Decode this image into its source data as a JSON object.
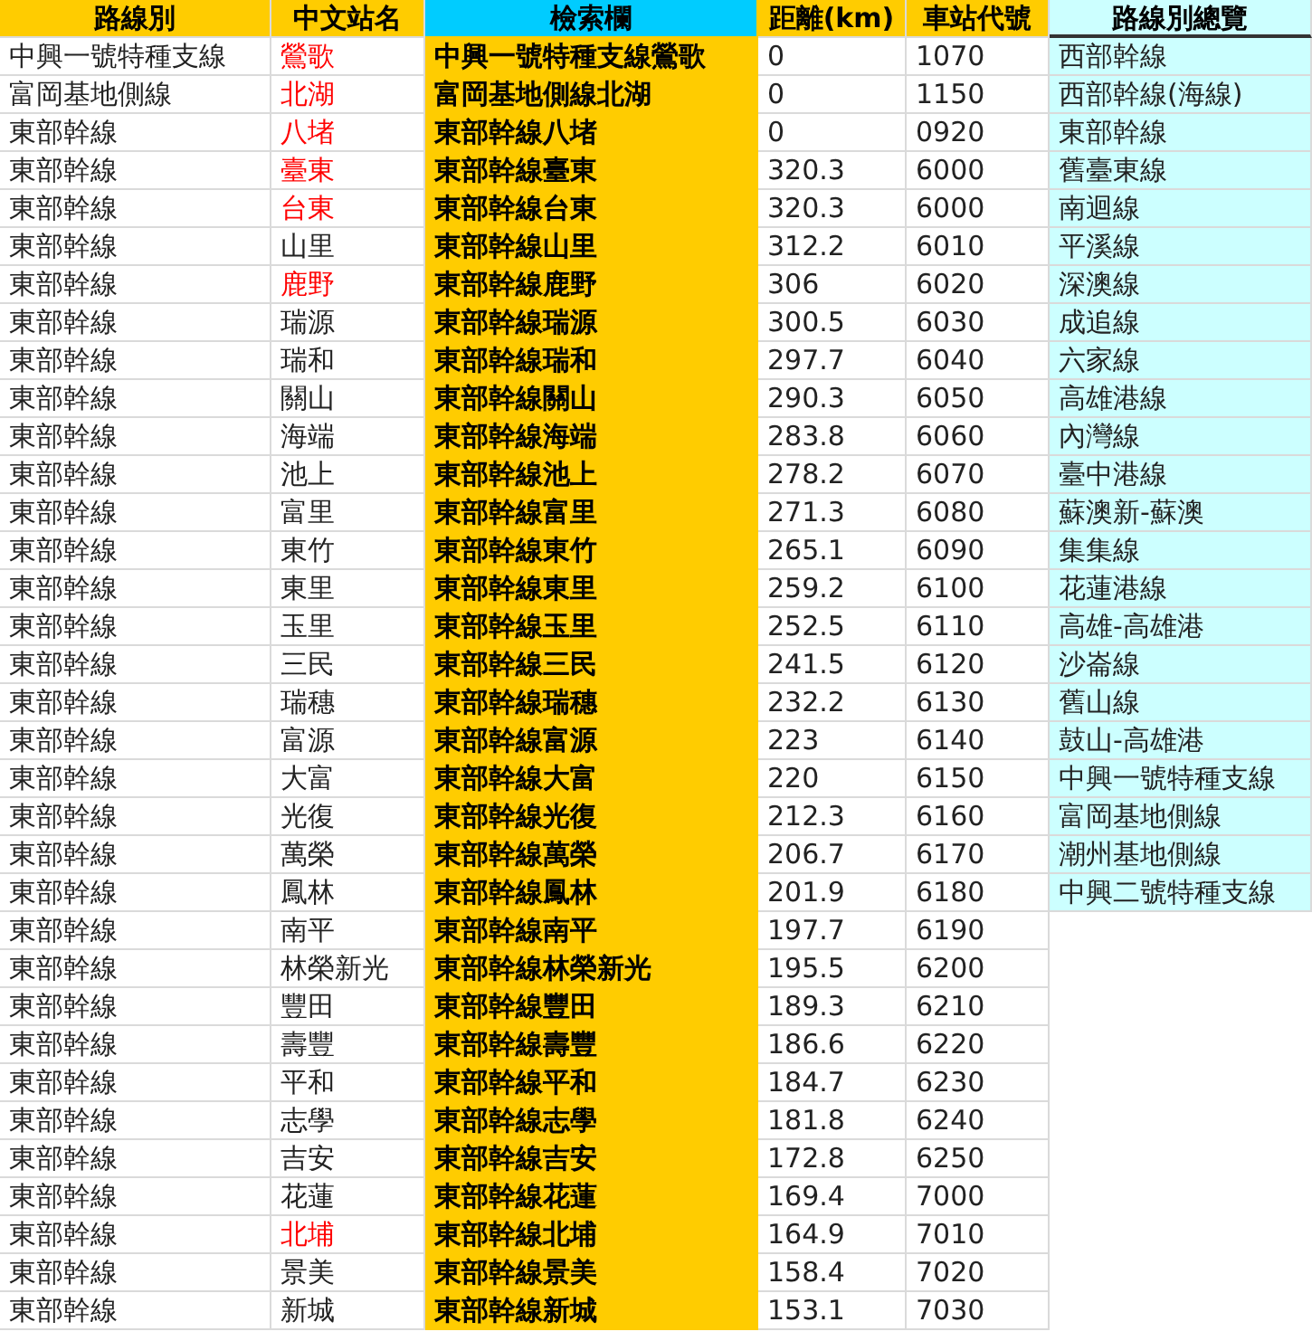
{
  "columns": [
    {
      "label": "路線別",
      "kind": "plain"
    },
    {
      "label": "中文站名",
      "kind": "plain"
    },
    {
      "label": "檢索欄",
      "kind": "search"
    },
    {
      "label": "距離(km)",
      "kind": "plain"
    },
    {
      "label": "車站代號",
      "kind": "plain"
    },
    {
      "label": "路線別總覽",
      "kind": "overview"
    }
  ],
  "rows": [
    {
      "route": "中興一號特種支線",
      "station": "鶯歌",
      "highlighted": true,
      "search_key": "中興一號特種支線鶯歌",
      "distance": "0",
      "code": "1070"
    },
    {
      "route": "富岡基地側線",
      "station": "北湖",
      "highlighted": true,
      "search_key": "富岡基地側線北湖",
      "distance": "0",
      "code": "1150"
    },
    {
      "route": "東部幹線",
      "station": "八堵",
      "highlighted": true,
      "search_key": "東部幹線八堵",
      "distance": "0",
      "code": "0920"
    },
    {
      "route": "東部幹線",
      "station": "臺東",
      "highlighted": true,
      "search_key": "東部幹線臺東",
      "distance": "320.3",
      "code": "6000"
    },
    {
      "route": "東部幹線",
      "station": "台東",
      "highlighted": true,
      "search_key": "東部幹線台東",
      "distance": "320.3",
      "code": "6000"
    },
    {
      "route": "東部幹線",
      "station": "山里",
      "highlighted": false,
      "search_key": "東部幹線山里",
      "distance": "312.2",
      "code": "6010"
    },
    {
      "route": "東部幹線",
      "station": "鹿野",
      "highlighted": true,
      "search_key": "東部幹線鹿野",
      "distance": "306",
      "code": "6020"
    },
    {
      "route": "東部幹線",
      "station": "瑞源",
      "highlighted": false,
      "search_key": "東部幹線瑞源",
      "distance": "300.5",
      "code": "6030"
    },
    {
      "route": "東部幹線",
      "station": "瑞和",
      "highlighted": false,
      "search_key": "東部幹線瑞和",
      "distance": "297.7",
      "code": "6040"
    },
    {
      "route": "東部幹線",
      "station": "關山",
      "highlighted": false,
      "search_key": "東部幹線關山",
      "distance": "290.3",
      "code": "6050"
    },
    {
      "route": "東部幹線",
      "station": "海端",
      "highlighted": false,
      "search_key": "東部幹線海端",
      "distance": "283.8",
      "code": "6060"
    },
    {
      "route": "東部幹線",
      "station": "池上",
      "highlighted": false,
      "search_key": "東部幹線池上",
      "distance": "278.2",
      "code": "6070"
    },
    {
      "route": "東部幹線",
      "station": "富里",
      "highlighted": false,
      "search_key": "東部幹線富里",
      "distance": "271.3",
      "code": "6080"
    },
    {
      "route": "東部幹線",
      "station": "東竹",
      "highlighted": false,
      "search_key": "東部幹線東竹",
      "distance": "265.1",
      "code": "6090"
    },
    {
      "route": "東部幹線",
      "station": "東里",
      "highlighted": false,
      "search_key": "東部幹線東里",
      "distance": "259.2",
      "code": "6100"
    },
    {
      "route": "東部幹線",
      "station": "玉里",
      "highlighted": false,
      "search_key": "東部幹線玉里",
      "distance": "252.5",
      "code": "6110"
    },
    {
      "route": "東部幹線",
      "station": "三民",
      "highlighted": false,
      "search_key": "東部幹線三民",
      "distance": "241.5",
      "code": "6120"
    },
    {
      "route": "東部幹線",
      "station": "瑞穗",
      "highlighted": false,
      "search_key": "東部幹線瑞穗",
      "distance": "232.2",
      "code": "6130"
    },
    {
      "route": "東部幹線",
      "station": "富源",
      "highlighted": false,
      "search_key": "東部幹線富源",
      "distance": "223",
      "code": "6140"
    },
    {
      "route": "東部幹線",
      "station": "大富",
      "highlighted": false,
      "search_key": "東部幹線大富",
      "distance": "220",
      "code": "6150"
    },
    {
      "route": "東部幹線",
      "station": "光復",
      "highlighted": false,
      "search_key": "東部幹線光復",
      "distance": "212.3",
      "code": "6160"
    },
    {
      "route": "東部幹線",
      "station": "萬榮",
      "highlighted": false,
      "search_key": "東部幹線萬榮",
      "distance": "206.7",
      "code": "6170"
    },
    {
      "route": "東部幹線",
      "station": "鳳林",
      "highlighted": false,
      "search_key": "東部幹線鳳林",
      "distance": "201.9",
      "code": "6180"
    },
    {
      "route": "東部幹線",
      "station": "南平",
      "highlighted": false,
      "search_key": "東部幹線南平",
      "distance": "197.7",
      "code": "6190"
    },
    {
      "route": "東部幹線",
      "station": "林榮新光",
      "highlighted": false,
      "search_key": "東部幹線林榮新光",
      "distance": "195.5",
      "code": "6200"
    },
    {
      "route": "東部幹線",
      "station": "豐田",
      "highlighted": false,
      "search_key": "東部幹線豐田",
      "distance": "189.3",
      "code": "6210"
    },
    {
      "route": "東部幹線",
      "station": "壽豐",
      "highlighted": false,
      "search_key": "東部幹線壽豐",
      "distance": "186.6",
      "code": "6220"
    },
    {
      "route": "東部幹線",
      "station": "平和",
      "highlighted": false,
      "search_key": "東部幹線平和",
      "distance": "184.7",
      "code": "6230"
    },
    {
      "route": "東部幹線",
      "station": "志學",
      "highlighted": false,
      "search_key": "東部幹線志學",
      "distance": "181.8",
      "code": "6240"
    },
    {
      "route": "東部幹線",
      "station": "吉安",
      "highlighted": false,
      "search_key": "東部幹線吉安",
      "distance": "172.8",
      "code": "6250"
    },
    {
      "route": "東部幹線",
      "station": "花蓮",
      "highlighted": false,
      "search_key": "東部幹線花蓮",
      "distance": "169.4",
      "code": "7000"
    },
    {
      "route": "東部幹線",
      "station": "北埔",
      "highlighted": true,
      "search_key": "東部幹線北埔",
      "distance": "164.9",
      "code": "7010"
    },
    {
      "route": "東部幹線",
      "station": "景美",
      "highlighted": false,
      "search_key": "東部幹線景美",
      "distance": "158.4",
      "code": "7020"
    },
    {
      "route": "東部幹線",
      "station": "新城",
      "highlighted": false,
      "search_key": "東部幹線新城",
      "distance": "153.1",
      "code": "7030"
    }
  ],
  "overview": [
    "西部幹線",
    "西部幹線(海線)",
    "東部幹線",
    "舊臺東線",
    "南迴線",
    "平溪線",
    "深澳線",
    "成追線",
    "六家線",
    "高雄港線",
    "內灣線",
    "臺中港線",
    "蘇澳新-蘇澳",
    "集集線",
    "花蓮港線",
    "高雄-高雄港",
    "沙崙線",
    "舊山線",
    "鼓山-高雄港",
    "中興一號特種支線",
    "富岡基地側線",
    "潮州基地側線",
    "中興二號特種支線"
  ]
}
